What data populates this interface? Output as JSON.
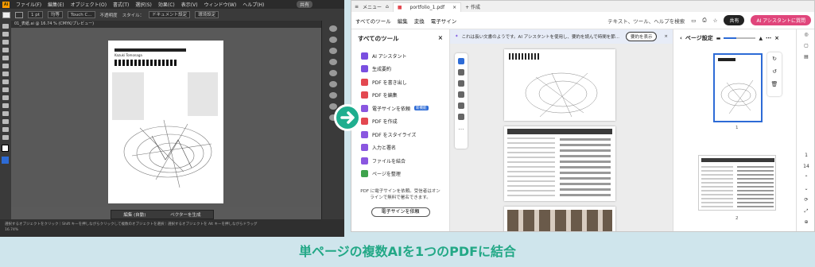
{
  "illustrator": {
    "menu": [
      "ファイル(F)",
      "編集(E)",
      "オブジェクト(O)",
      "書式(T)",
      "選択(S)",
      "効果(C)",
      "表示(V)",
      "ウィンドウ(W)",
      "ヘルプ(H)"
    ],
    "share": "共有",
    "control": {
      "stroke": "1 pt",
      "style_label": "均等",
      "brush": "Touch C...",
      "opacity": "不透明度",
      "style": "スタイル：",
      "doc_settings": "ドキュメント設定",
      "prefs": "環境設定"
    },
    "doc_tab": "01_表紙.ai @ 16.74 % (CMYK/プレビュー)",
    "float_bar": {
      "edit": "編集 (自動)",
      "vector": "ベクターを生成"
    },
    "status_line1": "選択するオブジェクトをクリック｜Shift キーを押しながらクリックして複数のオブジェクトを選択｜選択するオブジェクトを Alt キーを押しながらドラッグ",
    "zoom": "16.74%",
    "artboard_title": "Kazuki Tomonaga"
  },
  "acrobat": {
    "menu_label": "メニュー",
    "tab_title": "portfolio_1.pdf",
    "new_tab": "+ 作成",
    "toolbar": {
      "all_tools": "すべてのツール",
      "edit": "編集",
      "convert": "変換",
      "esign": "電子サイン",
      "search": "テキスト、ツール、ヘルプを検索",
      "share": "共有",
      "ai_assistant": "AI アシスタントに質問"
    },
    "left_panel": {
      "title": "すべてのツール",
      "tools": [
        {
          "label": "AI アシスタント",
          "color": "#7a4fe0"
        },
        {
          "label": "生成要約",
          "color": "#7a4fe0"
        },
        {
          "label": "PDF を書き出し",
          "color": "#e34850"
        },
        {
          "label": "PDF を編集",
          "color": "#e34850"
        },
        {
          "label": "電子サインを依頼",
          "color": "#8a56e0",
          "badge": "新機能"
        },
        {
          "label": "PDF を作成",
          "color": "#e34850"
        },
        {
          "label": "PDF をスタイライズ",
          "color": "#8a56e0"
        },
        {
          "label": "入力と署名",
          "color": "#8a56e0"
        },
        {
          "label": "ファイルを結合",
          "color": "#8a56e0"
        },
        {
          "label": "ページを整理",
          "color": "#3fa34d"
        }
      ],
      "note": "PDF に電子サインを依頼。受信者はオンラインで無料で署名できます。",
      "request_button": "電子サインを依頼"
    },
    "banner": {
      "text": "これは長い文書のようです。AI アシスタントを使用し、要約を読んで時間を節...",
      "button": "要約を表示"
    },
    "page_panel": {
      "title": "ページ設定",
      "thumbs": [
        "1",
        "2"
      ]
    },
    "page_counter": {
      "current": "1",
      "total": "14"
    }
  },
  "caption": "単ページの複数AIを1つのPDFに結合",
  "colors": {
    "accent": "#1fae8f",
    "blue": "#2d6bd6",
    "ai_pink": "#e0457b"
  }
}
